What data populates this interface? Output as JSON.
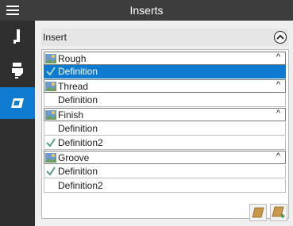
{
  "window": {
    "title": "Inserts"
  },
  "sidebar": {
    "items": [
      {
        "name": "tool-icon"
      },
      {
        "name": "holder-icon"
      },
      {
        "name": "insert-icon",
        "active": true
      }
    ]
  },
  "panel": {
    "header_label": "Insert",
    "groups": [
      {
        "label": "Rough",
        "items": [
          {
            "label": "Definition",
            "checked": true,
            "selected": true
          }
        ]
      },
      {
        "label": "Thread",
        "items": [
          {
            "label": "Definition",
            "checked": false
          }
        ]
      },
      {
        "label": "Finish",
        "items": [
          {
            "label": "Definition",
            "checked": false
          },
          {
            "label": "Definition2",
            "checked": true
          }
        ]
      },
      {
        "label": "Groove",
        "items": [
          {
            "label": "Definition",
            "checked": true
          },
          {
            "label": "Definition2",
            "checked": false
          }
        ]
      }
    ]
  },
  "colors": {
    "accent": "#0e7ad0",
    "titlebar": "#3d3d3d",
    "sidebar": "#2f2f2f",
    "check": "#5b9a8b"
  }
}
